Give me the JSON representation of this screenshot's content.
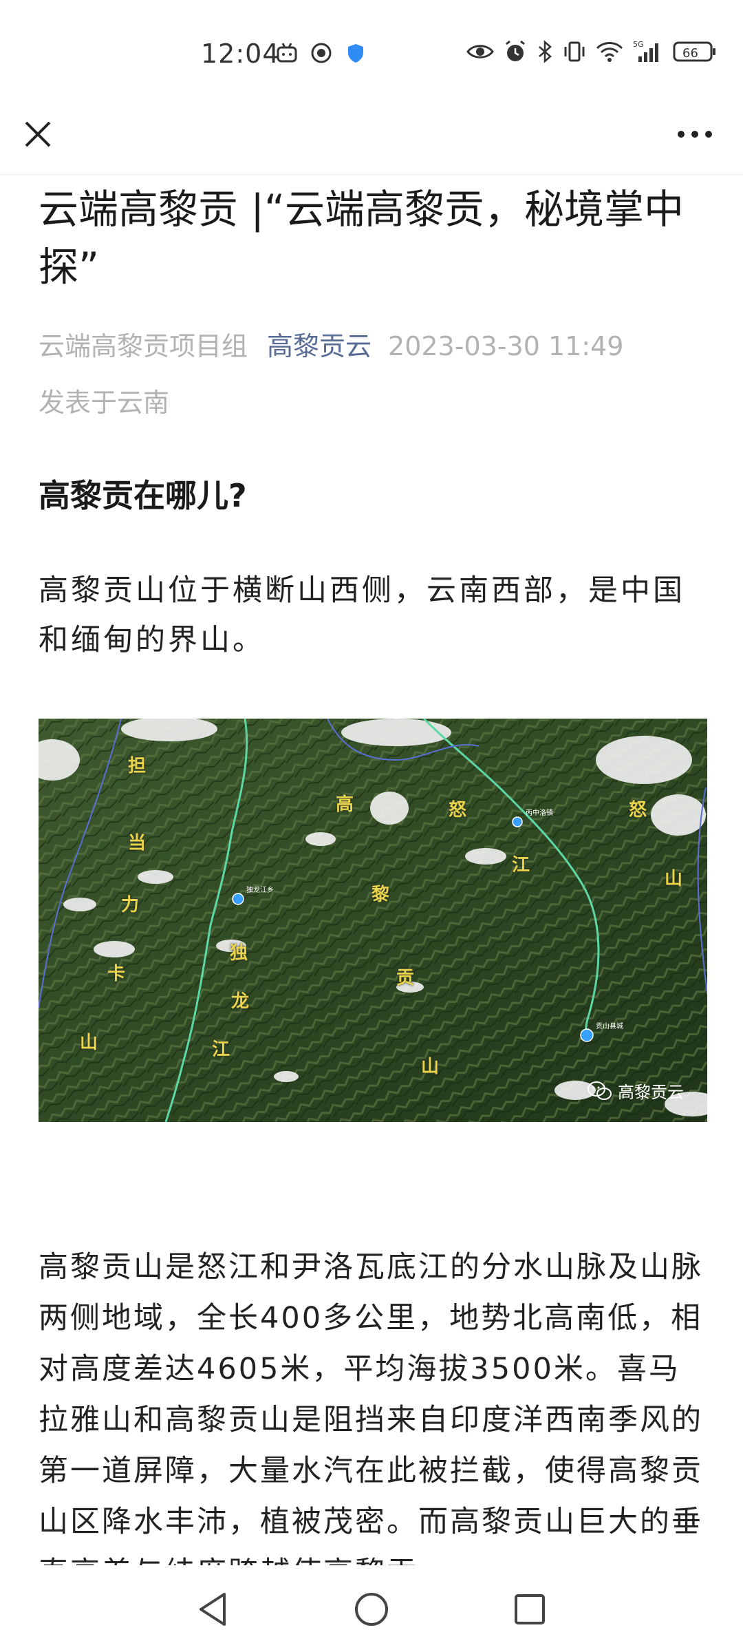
{
  "status_bar": {
    "time": "12:04",
    "battery": "66",
    "left_icons": [
      "bilibili-icon",
      "record-icon",
      "shield-icon"
    ],
    "right_icons": [
      "eye-icon",
      "alarm-icon",
      "bluetooth-icon",
      "vibrate-icon",
      "wifi-icon",
      "signal-5g-icon",
      "battery-icon"
    ],
    "network": "5G"
  },
  "nav": {
    "close_icon": "close-icon",
    "more_icon": "more-icon"
  },
  "article": {
    "title": "云端高黎贡 |“云端高黎贡，秘境掌中探”",
    "author": "云端高黎贡项目组",
    "account": "高黎贡云",
    "datetime": "2023-03-30 11:49",
    "location": "发表于云南",
    "heading": "高黎贡在哪儿?",
    "paragraph1": "高黎贡山位于横断山西侧，云南西部，是中国和缅甸的界山。",
    "map": {
      "labels": [
        "担",
        "当",
        "力",
        "卡",
        "山",
        "独",
        "龙",
        "江",
        "高",
        "黎",
        "贡",
        "山",
        "怒",
        "江",
        "怒",
        "山"
      ],
      "places": [
        "独龙江乡",
        "丙中洛镇",
        "贡山县城"
      ],
      "watermark": "高黎贡云"
    },
    "paragraph2": "高黎贡山是怒江和尹洛瓦底江的分水山脉及山脉两侧地域，全长400多公里，地势北高南低，相对高度差达4605米，平均海拔3500米。喜马拉雅山和高黎贡山是阻挡来自印度洋西南季风的第一道屏障，大量水汽在此被拦截，使得高黎贡山区降水丰沛，植被茂密。而高黎贡山巨大的垂直高差与纬度跨越使高黎贡"
  },
  "bottom_nav": {
    "back_icon": "back-triangle-icon",
    "home_icon": "home-circle-icon",
    "recents_icon": "recents-square-icon"
  }
}
